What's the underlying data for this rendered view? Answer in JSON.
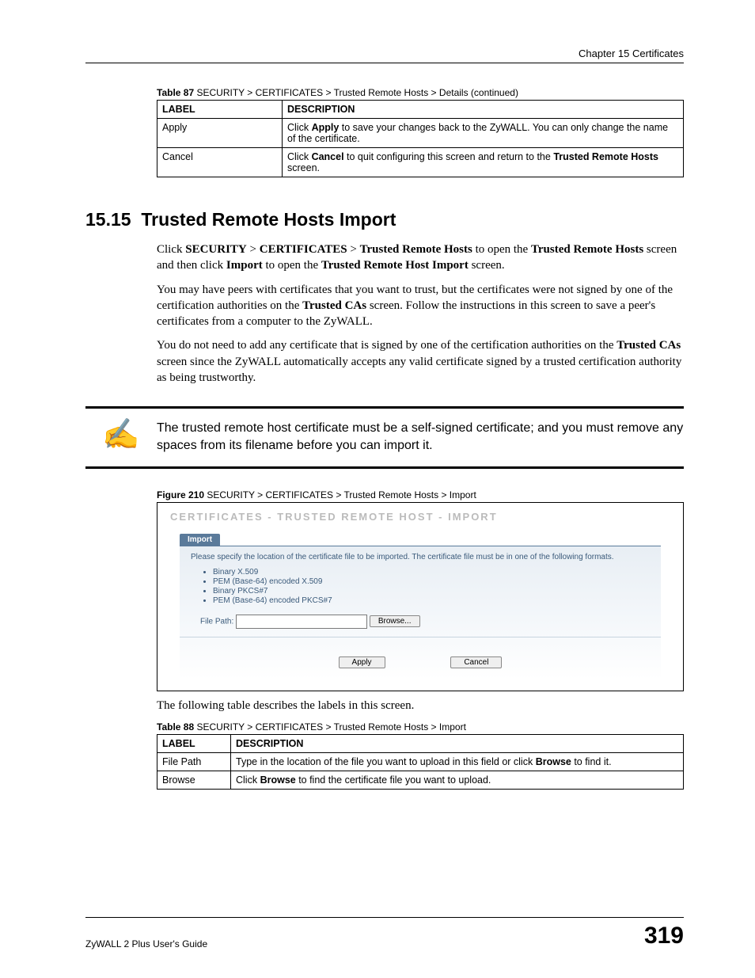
{
  "header": {
    "chapter": "Chapter 15 Certificates"
  },
  "table87": {
    "caption_bold": "Table 87",
    "caption_rest": "   SECURITY > CERTIFICATES > Trusted Remote Hosts > Details (continued)",
    "headers": {
      "label": "LABEL",
      "description": "DESCRIPTION"
    },
    "rows": [
      {
        "label": "Apply",
        "pre": "Click ",
        "b1": "Apply",
        "post": " to save your changes back to the ZyWALL. You can only change the name of the certificate."
      },
      {
        "label": "Cancel",
        "pre": "Click ",
        "b1": "Cancel",
        "mid": " to quit configuring this screen and return to the ",
        "b2": "Trusted Remote Hosts",
        "post": " screen."
      }
    ]
  },
  "section": {
    "number": "15.15",
    "title": "Trusted Remote Hosts Import"
  },
  "para1": {
    "t1": "Click ",
    "b1": "SECURITY",
    "t2": " > ",
    "b2": "CERTIFICATES",
    "t3": " > ",
    "b3": "Trusted Remote Hosts",
    "t4": " to open the ",
    "b4": "Trusted Remote Hosts",
    "t5": " screen and then click ",
    "b5": "Import",
    "t6": " to open the ",
    "b6": "Trusted Remote Host Import",
    "t7": " screen."
  },
  "para2": {
    "t1": "You may have peers with certificates that you want to trust, but the certificates were not signed by one of the certification authorities on the ",
    "b1": "Trusted CAs",
    "t2": " screen. Follow the instructions in this screen to save a peer's certificates from a computer to the ZyWALL."
  },
  "para3": {
    "t1": "You do not need to add any certificate that is signed by one of the certification authorities on the ",
    "b1": "Trusted CAs",
    "t2": " screen since the ZyWALL automatically accepts any valid certificate signed by a trusted certification authority as being trustworthy."
  },
  "note": {
    "text": "The trusted remote host certificate must be a self-signed certificate; and you must remove any spaces from its filename before you can import it."
  },
  "figure": {
    "caption_bold": "Figure 210",
    "caption_rest": "   SECURITY > CERTIFICATES > Trusted Remote Hosts > Import",
    "panel_title": "CERTIFICATES - TRUSTED REMOTE HOST - IMPORT",
    "tab": "Import",
    "instruction": "Please specify the location of the certificate file to be imported. The certificate file must be in one of the following formats.",
    "formats": [
      "Binary X.509",
      "PEM (Base-64) encoded X.509",
      "Binary PKCS#7",
      "PEM (Base-64) encoded PKCS#7"
    ],
    "file_label": "File Path:",
    "browse": "Browse...",
    "apply": "Apply",
    "cancel": "Cancel"
  },
  "para4": "The following table describes the labels in this screen.",
  "table88": {
    "caption_bold": "Table 88",
    "caption_rest": "   SECURITY > CERTIFICATES > Trusted Remote Hosts > Import",
    "headers": {
      "label": "LABEL",
      "description": "DESCRIPTION"
    },
    "rows": [
      {
        "label": "File Path",
        "pre": "Type in the location of the file you want to upload in this field or click ",
        "b1": "Browse",
        "post": " to find it."
      },
      {
        "label": "Browse",
        "pre": "Click ",
        "b1": "Browse",
        "post": " to find the certificate file you want to upload."
      }
    ]
  },
  "footer": {
    "guide": "ZyWALL 2 Plus User's Guide",
    "page": "319"
  }
}
